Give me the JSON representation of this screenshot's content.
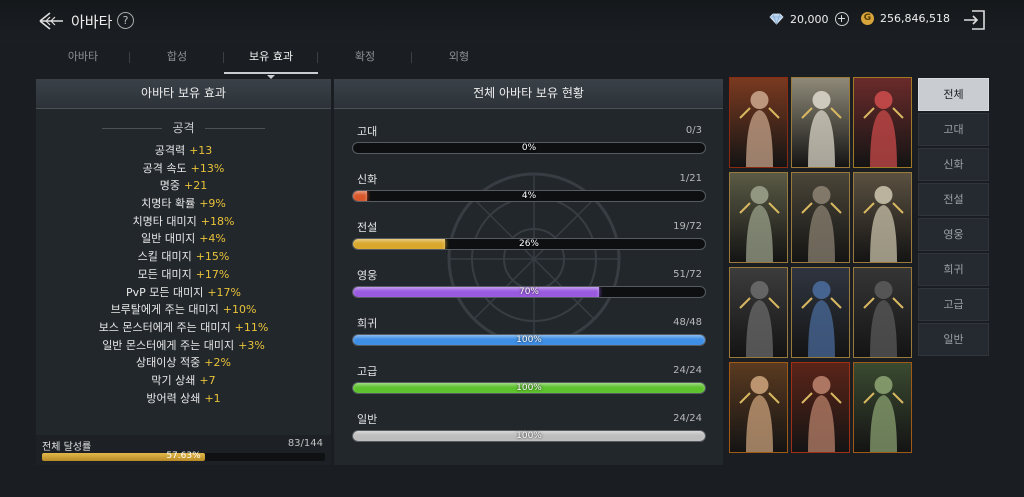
{
  "header": {
    "title": "아바타",
    "help": "?"
  },
  "currency": {
    "diamond": "20,000",
    "gold": "256,846,518",
    "gold_symbol": "G",
    "plus": "+"
  },
  "tabs": [
    {
      "label": "아바타"
    },
    {
      "label": "합성"
    },
    {
      "label": "보유 효과",
      "active": true
    },
    {
      "label": "확정"
    },
    {
      "label": "외형"
    }
  ],
  "left_panel": {
    "title": "아바타 보유 효과",
    "category": "공격",
    "stats": [
      {
        "name": "공격력",
        "value": "+13"
      },
      {
        "name": "공격 속도",
        "value": "+13%"
      },
      {
        "name": "명중",
        "value": "+21"
      },
      {
        "name": "치명타 확률",
        "value": "+9%"
      },
      {
        "name": "치명타 대미지",
        "value": "+18%"
      },
      {
        "name": "일반 대미지",
        "value": "+4%"
      },
      {
        "name": "스킬 대미지",
        "value": "+15%"
      },
      {
        "name": "모든 대미지",
        "value": "+17%"
      },
      {
        "name": "PvP 모든 대미지",
        "value": "+17%"
      },
      {
        "name": "브루탈에게 주는 대미지",
        "value": "+10%"
      },
      {
        "name": "보스 몬스터에게 주는 대미지",
        "value": "+11%"
      },
      {
        "name": "일반 몬스터에게 주는 대미지",
        "value": "+3%"
      },
      {
        "name": "상태이상 적중",
        "value": "+2%"
      },
      {
        "name": "막기 상쇄",
        "value": "+7"
      },
      {
        "name": "방어력 상쇄",
        "value": "+1"
      }
    ],
    "achievement": {
      "label": "전체 달성률",
      "count": "83/144",
      "percent_text": "57.63%",
      "percent": 57.63
    }
  },
  "mid_panel": {
    "title": "전체 아바타 보유 현황",
    "grades": [
      {
        "name": "고대",
        "count": "0/3",
        "pct_text": "0%",
        "pct": 0,
        "color": "#8a8a8a"
      },
      {
        "name": "신화",
        "count": "1/21",
        "pct_text": "4%",
        "pct": 4,
        "color": "#d8562a"
      },
      {
        "name": "전설",
        "count": "19/72",
        "pct_text": "26%",
        "pct": 26,
        "color": "#d9a72c"
      },
      {
        "name": "영웅",
        "count": "51/72",
        "pct_text": "70%",
        "pct": 70,
        "color": "#9a5ae0"
      },
      {
        "name": "희귀",
        "count": "48/48",
        "pct_text": "100%",
        "pct": 100,
        "color": "#3d8ee6"
      },
      {
        "name": "고급",
        "count": "24/24",
        "pct_text": "100%",
        "pct": 100,
        "color": "#5dc22d"
      },
      {
        "name": "일반",
        "count": "24/24",
        "pct_text": "100%",
        "pct": 100,
        "color": "#bdbdbd"
      }
    ]
  },
  "avatars": [
    {
      "frame": "#8a2a10",
      "bg": "#7a3a20",
      "figure": "#c7a389"
    },
    {
      "frame": "#9a7a3a",
      "bg": "#8f8a78",
      "figure": "#d8d4c6"
    },
    {
      "frame": "#a07a25",
      "bg": "#6a2a2a",
      "figure": "#c94a4a"
    },
    {
      "frame": "#9a7a3a",
      "bg": "#5a5a45",
      "figure": "#9aa08a"
    },
    {
      "frame": "#9a7a3a",
      "bg": "#4a4538",
      "figure": "#8a8070"
    },
    {
      "frame": "#9a7a3a",
      "bg": "#5a5040",
      "figure": "#c8c0a8"
    },
    {
      "frame": "#9a7a3a",
      "bg": "#3c3c3c",
      "figure": "#6a6a6a"
    },
    {
      "frame": "#9a7a3a",
      "bg": "#2f3540",
      "figure": "#4a6a9a"
    },
    {
      "frame": "#9a7a3a",
      "bg": "#353535",
      "figure": "#5a5a5a"
    },
    {
      "frame": "#a05a15",
      "bg": "#5a3a20",
      "figure": "#c9a07a"
    },
    {
      "frame": "#a03015",
      "bg": "#5a2418",
      "figure": "#b8806a"
    },
    {
      "frame": "#a05a15",
      "bg": "#3a4a30",
      "figure": "#8aa070"
    }
  ],
  "filters": [
    {
      "label": "전체",
      "active": true
    },
    {
      "label": "고대"
    },
    {
      "label": "신화"
    },
    {
      "label": "전설"
    },
    {
      "label": "영웅"
    },
    {
      "label": "희귀"
    },
    {
      "label": "고급"
    },
    {
      "label": "일반"
    }
  ]
}
